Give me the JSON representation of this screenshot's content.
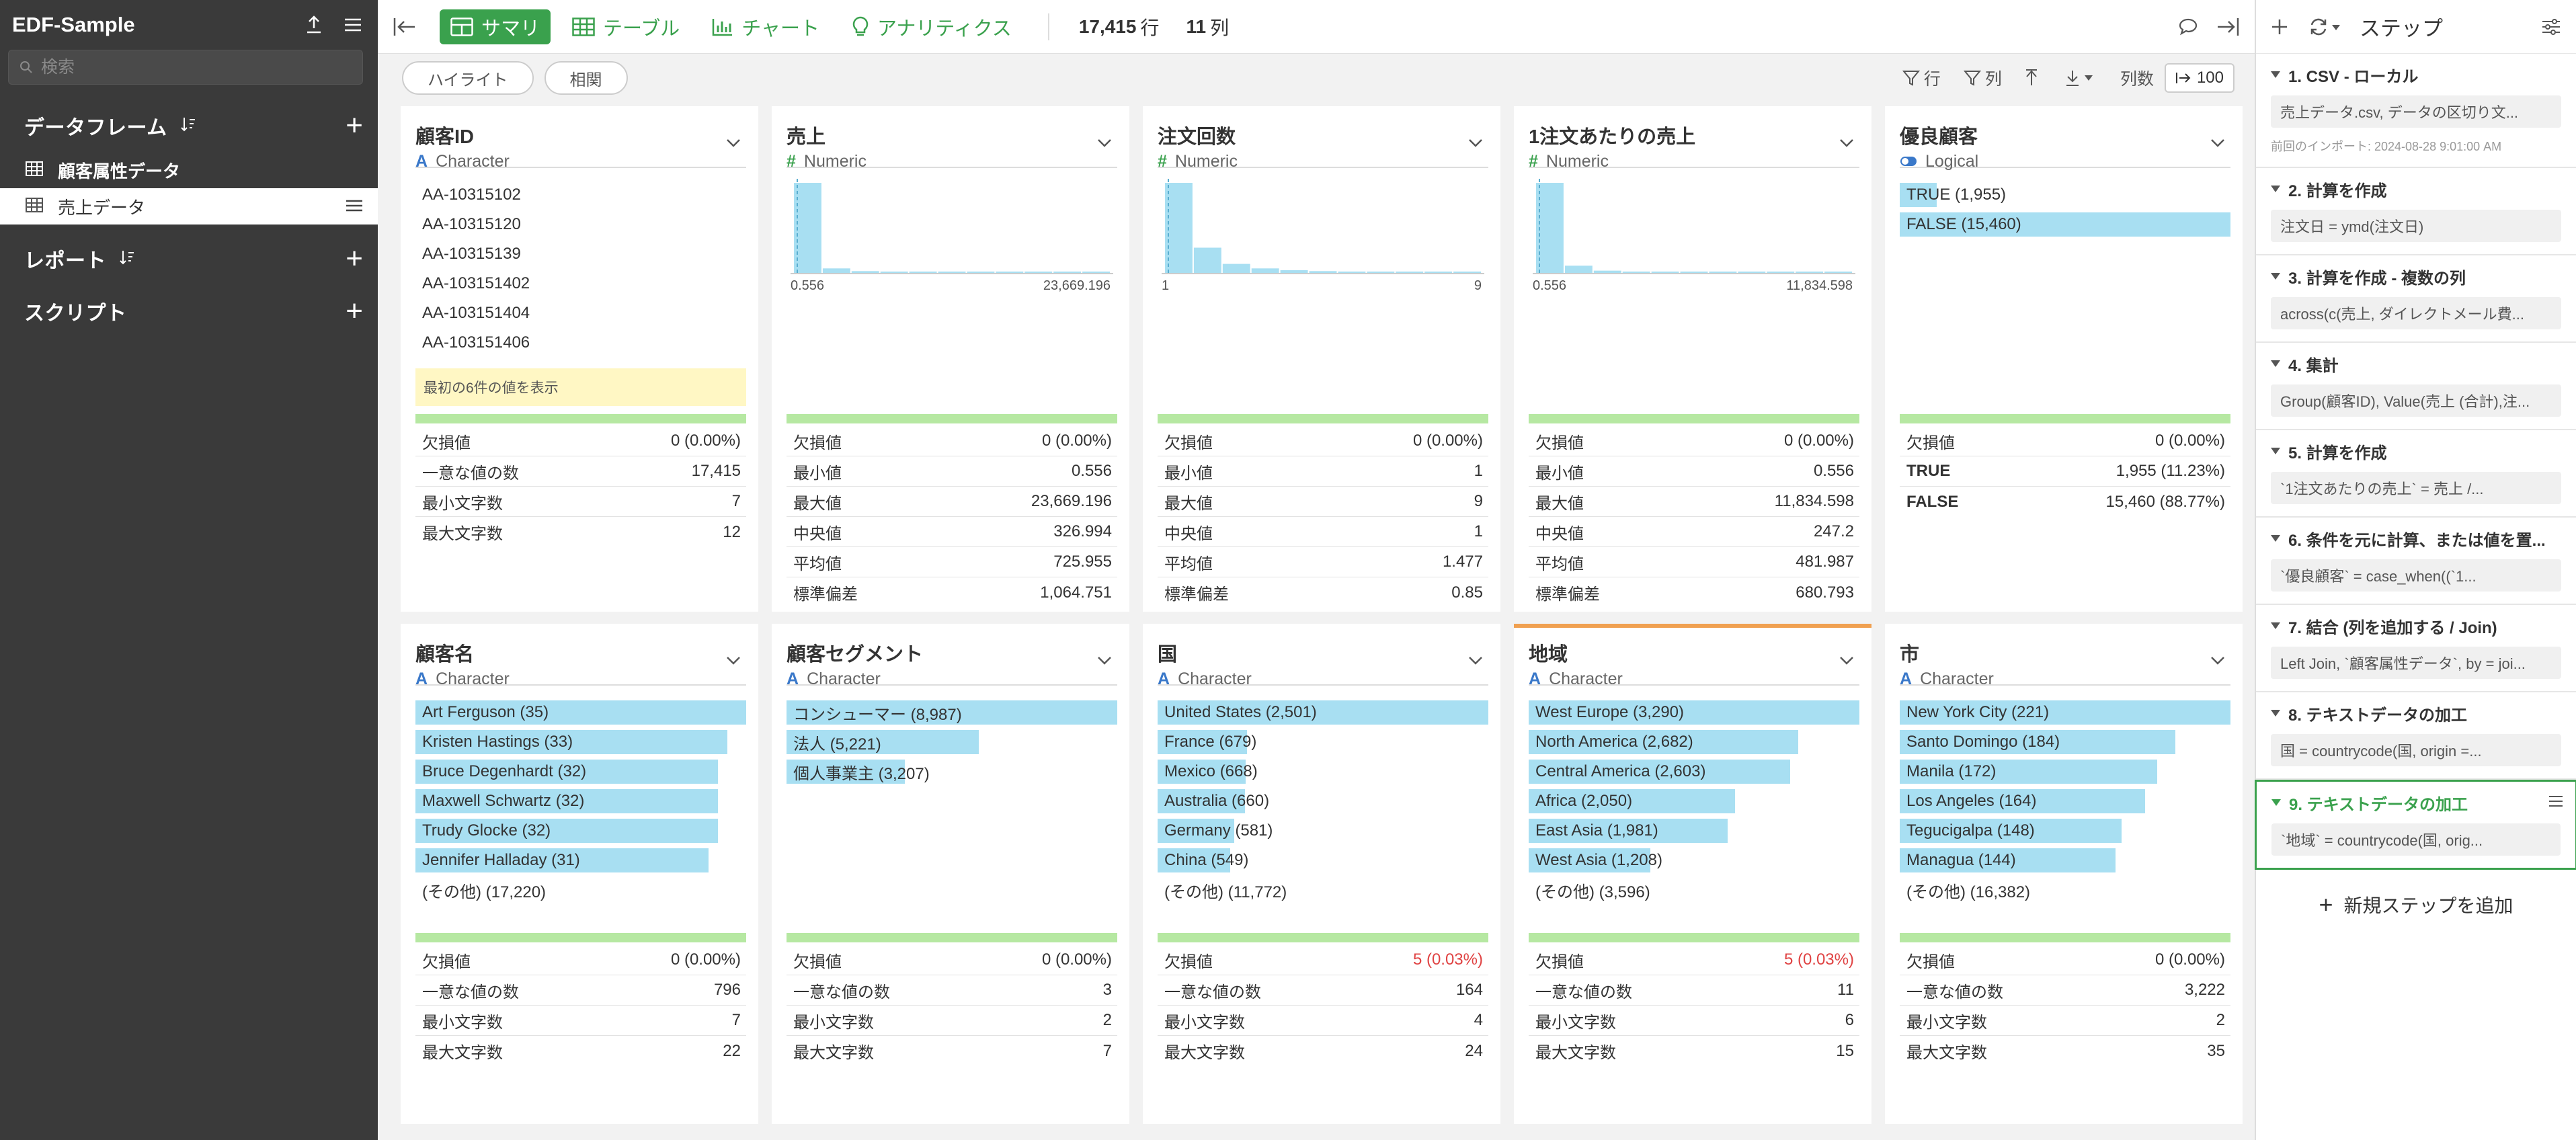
{
  "sidebar": {
    "project_title": "EDF-Sample",
    "search_placeholder": "検索",
    "dataframes_title": "データフレーム",
    "dataframes": [
      {
        "label": "顧客属性データ"
      },
      {
        "label": "売上データ"
      }
    ],
    "reports_title": "レポート",
    "scripts_title": "スクリプト"
  },
  "topbar": {
    "tabs": [
      {
        "label": "サマリ",
        "icon": "summary-grid-icon"
      },
      {
        "label": "テーブル",
        "icon": "table-icon"
      },
      {
        "label": "チャート",
        "icon": "chart-icon"
      },
      {
        "label": "アナリティクス",
        "icon": "lightbulb-icon"
      }
    ],
    "rows_count": "17,415",
    "rows_unit": "行",
    "cols_count": "11",
    "cols_unit": "列"
  },
  "subbar": {
    "highlight": "ハイライト",
    "correlation": "相関",
    "filter_rows": "行",
    "filter_cols": "列",
    "col_count_label": "列数",
    "col_count_value": "100"
  },
  "cards": [
    {
      "name": "顧客ID",
      "type": "Character",
      "type_kind": "char",
      "values": [
        "AA-10315102",
        "AA-10315120",
        "AA-10315139",
        "AA-103151402",
        "AA-103151404",
        "AA-103151406"
      ],
      "note": "最初の6件の値を表示",
      "stats": [
        {
          "k": "欠損値",
          "v": "0 (0.00%)"
        },
        {
          "k": "一意な値の数",
          "v": "17,415"
        },
        {
          "k": "最小文字数",
          "v": "7"
        },
        {
          "k": "最大文字数",
          "v": "12"
        }
      ]
    },
    {
      "name": "売上",
      "type": "Numeric",
      "type_kind": "num",
      "hist": {
        "min": "0.556",
        "max": "23,669.196",
        "bins": [
          1.0,
          0.05,
          0.02,
          0.012,
          0.01,
          0.008,
          0.006,
          0.005,
          0.004,
          0.003,
          0.002
        ]
      },
      "stats": [
        {
          "k": "欠損値",
          "v": "0 (0.00%)"
        },
        {
          "k": "最小値",
          "v": "0.556"
        },
        {
          "k": "最大値",
          "v": "23,669.196"
        },
        {
          "k": "中央値",
          "v": "326.994"
        },
        {
          "k": "平均値",
          "v": "725.955"
        },
        {
          "k": "標準偏差",
          "v": "1,064.751"
        }
      ]
    },
    {
      "name": "注文回数",
      "type": "Numeric",
      "type_kind": "num",
      "hist": {
        "min": "1",
        "max": "9",
        "bins": [
          1.0,
          0.28,
          0.1,
          0.05,
          0.03,
          0.02,
          0.015,
          0.01,
          0.008,
          0.006,
          0.005
        ]
      },
      "stats": [
        {
          "k": "欠損値",
          "v": "0 (0.00%)"
        },
        {
          "k": "最小値",
          "v": "1"
        },
        {
          "k": "最大値",
          "v": "9"
        },
        {
          "k": "中央値",
          "v": "1"
        },
        {
          "k": "平均値",
          "v": "1.477"
        },
        {
          "k": "標準偏差",
          "v": "0.85"
        }
      ]
    },
    {
      "name": "1注文あたりの売上",
      "type": "Numeric",
      "type_kind": "num",
      "hist": {
        "min": "0.556",
        "max": "11,834.598",
        "bins": [
          1.0,
          0.08,
          0.025,
          0.015,
          0.01,
          0.008,
          0.006,
          0.005,
          0.004,
          0.003,
          0.002
        ]
      },
      "stats": [
        {
          "k": "欠損値",
          "v": "0 (0.00%)"
        },
        {
          "k": "最小値",
          "v": "0.556"
        },
        {
          "k": "最大値",
          "v": "11,834.598"
        },
        {
          "k": "中央値",
          "v": "247.2"
        },
        {
          "k": "平均値",
          "v": "481.987"
        },
        {
          "k": "標準偏差",
          "v": "680.793"
        }
      ]
    },
    {
      "name": "優良顧客",
      "type": "Logical",
      "type_kind": "logical",
      "bars": [
        {
          "label": "TRUE (1,955)",
          "frac": 0.1123
        },
        {
          "label": "FALSE (15,460)",
          "frac": 1.0
        }
      ],
      "stats": [
        {
          "k": "欠損値",
          "v": "0 (0.00%)"
        },
        {
          "k": "TRUE",
          "v": "1,955 (11.23%)",
          "bold": true
        },
        {
          "k": "FALSE",
          "v": "15,460 (88.77%)",
          "bold": true
        }
      ]
    },
    {
      "name": "顧客名",
      "type": "Character",
      "type_kind": "char",
      "bars": [
        {
          "label": "Art Ferguson (35)",
          "frac": 1.0
        },
        {
          "label": "Kristen Hastings (33)",
          "frac": 0.943
        },
        {
          "label": "Bruce Degenhardt (32)",
          "frac": 0.914
        },
        {
          "label": "Maxwell Schwartz (32)",
          "frac": 0.914
        },
        {
          "label": "Trudy Glocke (32)",
          "frac": 0.914
        },
        {
          "label": "Jennifer Halladay (31)",
          "frac": 0.886
        }
      ],
      "other": "(その他) (17,220)",
      "stats": [
        {
          "k": "欠損値",
          "v": "0 (0.00%)"
        },
        {
          "k": "一意な値の数",
          "v": "796"
        },
        {
          "k": "最小文字数",
          "v": "7"
        },
        {
          "k": "最大文字数",
          "v": "22"
        }
      ]
    },
    {
      "name": "顧客セグメント",
      "type": "Character",
      "type_kind": "char",
      "bars": [
        {
          "label": "コンシューマー (8,987)",
          "frac": 1.0
        },
        {
          "label": "法人 (5,221)",
          "frac": 0.581
        },
        {
          "label": "個人事業主 (3,207)",
          "frac": 0.357
        }
      ],
      "stats": [
        {
          "k": "欠損値",
          "v": "0 (0.00%)"
        },
        {
          "k": "一意な値の数",
          "v": "3"
        },
        {
          "k": "最小文字数",
          "v": "2"
        },
        {
          "k": "最大文字数",
          "v": "7"
        }
      ]
    },
    {
      "name": "国",
      "type": "Character",
      "type_kind": "char",
      "bars": [
        {
          "label": "United States (2,501)",
          "frac": 1.0
        },
        {
          "label": "France (679)",
          "frac": 0.271
        },
        {
          "label": "Mexico (668)",
          "frac": 0.267
        },
        {
          "label": "Australia (660)",
          "frac": 0.264
        },
        {
          "label": "Germany (581)",
          "frac": 0.232
        },
        {
          "label": "China (549)",
          "frac": 0.22
        }
      ],
      "other": "(その他) (11,772)",
      "stats": [
        {
          "k": "欠損値",
          "v": "5 (0.03%)",
          "red": true
        },
        {
          "k": "一意な値の数",
          "v": "164"
        },
        {
          "k": "最小文字数",
          "v": "4"
        },
        {
          "k": "最大文字数",
          "v": "24"
        }
      ]
    },
    {
      "name": "地域",
      "type": "Character",
      "type_kind": "char",
      "accent": true,
      "bars": [
        {
          "label": "West Europe (3,290)",
          "frac": 1.0
        },
        {
          "label": "North America (2,682)",
          "frac": 0.815
        },
        {
          "label": "Central America (2,603)",
          "frac": 0.791
        },
        {
          "label": "Africa (2,050)",
          "frac": 0.623
        },
        {
          "label": "East Asia (1,981)",
          "frac": 0.602
        },
        {
          "label": "West Asia (1,208)",
          "frac": 0.367
        }
      ],
      "other": "(その他) (3,596)",
      "stats": [
        {
          "k": "欠損値",
          "v": "5 (0.03%)",
          "red": true
        },
        {
          "k": "一意な値の数",
          "v": "11"
        },
        {
          "k": "最小文字数",
          "v": "6"
        },
        {
          "k": "最大文字数",
          "v": "15"
        }
      ]
    },
    {
      "name": "市",
      "type": "Character",
      "type_kind": "char",
      "bars": [
        {
          "label": "New York City (221)",
          "frac": 1.0
        },
        {
          "label": "Santo Domingo (184)",
          "frac": 0.833
        },
        {
          "label": "Manila (172)",
          "frac": 0.778
        },
        {
          "label": "Los Angeles (164)",
          "frac": 0.742
        },
        {
          "label": "Tegucigalpa (148)",
          "frac": 0.67
        },
        {
          "label": "Managua (144)",
          "frac": 0.652
        }
      ],
      "other": "(その他) (16,382)",
      "stats": [
        {
          "k": "欠損値",
          "v": "0 (0.00%)"
        },
        {
          "k": "一意な値の数",
          "v": "3,222"
        },
        {
          "k": "最小文字数",
          "v": "2"
        },
        {
          "k": "最大文字数",
          "v": "35"
        }
      ]
    }
  ],
  "steps_panel": {
    "title": "ステップ",
    "steps": [
      {
        "title": "1. CSV - ローカル",
        "body": "売上データ.csv, データの区切り文...",
        "body_bold": "データの区切り文...",
        "sub": "前回のインポート: 2024-08-28 9:01:00 AM"
      },
      {
        "title": "2. 計算を作成",
        "body": "注文日 = ymd(注文日)"
      },
      {
        "title": "3. 計算を作成 - 複数の列",
        "body": "across(c(売上, ダイレクトメール費..."
      },
      {
        "title": "4. 集計",
        "body": "Group(顧客ID), Value(売上 (合計),注..."
      },
      {
        "title": "5. 計算を作成",
        "body": "`1注文あたりの売上` = 売上 /..."
      },
      {
        "title": "6. 条件を元に計算、または値を置...",
        "body": "`優良顧客` = case_when((`1..."
      },
      {
        "title": "7. 結合 (列を追加する / Join)",
        "body": "Left Join, `顧客属性データ`, by = joi..."
      },
      {
        "title": "8. テキストデータの加工",
        "body": "国 = countrycode(国, origin =..."
      },
      {
        "title": "9. テキストデータの加工",
        "body": "`地域` = countrycode(国, orig...",
        "selected": true
      }
    ],
    "add_step": "新規ステップを追加"
  },
  "colors": {
    "accent_green": "#3aa14d",
    "bar_blue": "#a8dff2",
    "sidebar_bg": "#3a3a3a",
    "missing_red": "#e04343",
    "selected_col_accent": "#f0a050"
  }
}
